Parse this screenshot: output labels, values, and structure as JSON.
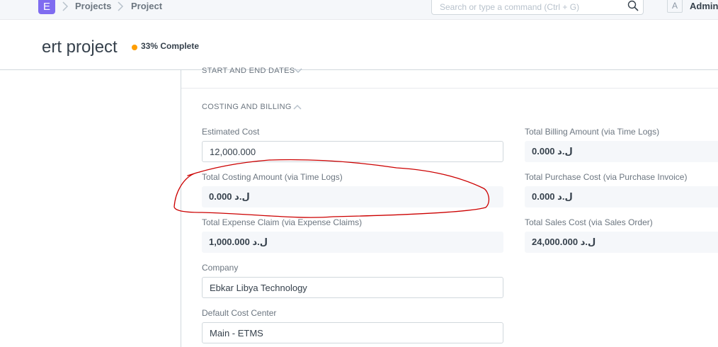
{
  "navbar": {
    "logo": "E",
    "breadcrumbs": [
      "Projects",
      "Project"
    ],
    "search_placeholder": "Search or type a command (Ctrl + G)",
    "avatar_initial": "A",
    "user": "Admini"
  },
  "page": {
    "title": "ert project",
    "status": "33% Complete",
    "status_color": "#ff9e00"
  },
  "sections": {
    "dates_title": "START AND END DATES",
    "costing_title": "COSTING AND BILLING"
  },
  "fields": {
    "estimated_cost": {
      "label": "Estimated Cost",
      "value": "12,000.000"
    },
    "total_costing_amount": {
      "label": "Total Costing Amount (via Time Logs)",
      "value": "0.000 ل.د"
    },
    "total_expense_claim": {
      "label": "Total Expense Claim (via Expense Claims)",
      "value": "1,000.000 ل.د"
    },
    "company": {
      "label": "Company",
      "value": "Ebkar Libya Technology"
    },
    "default_cost_center": {
      "label": "Default Cost Center",
      "value": "Main - ETMS"
    },
    "total_billing_amount": {
      "label": "Total Billing Amount (via Time Logs)",
      "value": "0.000 ل.د"
    },
    "total_purchase_cost": {
      "label": "Total Purchase Cost (via Purchase Invoice)",
      "value": "0.000 ل.د"
    },
    "total_sales_cost": {
      "label": "Total Sales Cost (via Sales Order)",
      "value": "24,000.000 ل.د"
    }
  },
  "annotation_color": "#cc0000"
}
